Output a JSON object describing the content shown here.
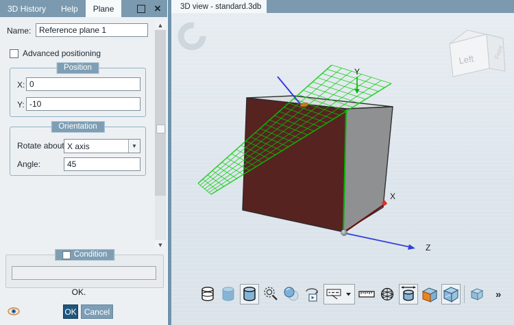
{
  "left_panel": {
    "tabs": [
      {
        "label": "3D History",
        "active": false
      },
      {
        "label": "Help",
        "active": false
      },
      {
        "label": "Plane",
        "active": true
      }
    ],
    "window_buttons": {
      "close": "✕"
    },
    "name_field": {
      "label": "Name:",
      "value": "Reference plane 1"
    },
    "advanced_checkbox": {
      "label": "Advanced positioning",
      "checked": false
    },
    "position_group": {
      "title": "Position",
      "x_label": "X:",
      "x_value": "0",
      "y_label": "Y:",
      "y_value": "-10"
    },
    "orientation_group": {
      "title": "Orientation",
      "rotate_label": "Rotate about",
      "rotate_value": "X axis",
      "angle_label": "Angle:",
      "angle_value": "45"
    },
    "condition_group": {
      "title": "Condition",
      "checked": false,
      "expression": ""
    },
    "status_text": "OK.",
    "buttons": {
      "ok": "OK",
      "cancel": "Cancel"
    }
  },
  "view": {
    "tab_title": "3D view - standard.3db",
    "axis_labels": {
      "x": "X",
      "y": "Y",
      "z": "Z"
    },
    "nav_cube": {
      "front_face": "Left",
      "side_face": "Front"
    },
    "toolbar": {
      "icons": [
        "wireframe-cylinder-icon",
        "shaded-cylinder-icon",
        "shaded-edges-cylinder-icon",
        "zoom-all-icon",
        "transparency-icon",
        "rotate-view-icon",
        "view-options-dropdown",
        "ruler-icon",
        "mesh-sphere-icon",
        "dimension-cylinder-icon",
        "section-solid-icon",
        "shaded-cube-icon",
        "light-cube-icon"
      ],
      "overflow": "»"
    }
  },
  "scene": {
    "colors": {
      "cube_front": "#562321",
      "cube_right": "#8e9092",
      "cube_top": "#dadde0",
      "plane_green": "#00cc00",
      "edge_green": "#00b400",
      "axis_x_red": "#6b100e",
      "arrow_red": "#e23022",
      "axis_z_blue": "#3240d8",
      "axis_y_blue": "#3a3ae0",
      "origin_orange": "#d4731f"
    }
  }
}
